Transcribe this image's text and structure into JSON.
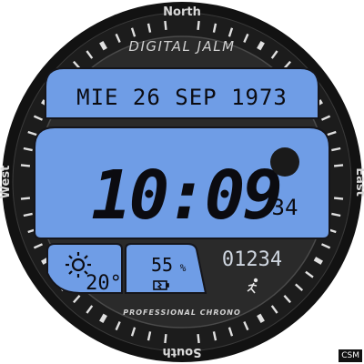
{
  "bezel": {
    "north": "North",
    "south": "South",
    "east": "East",
    "west": "West"
  },
  "brand": "DIGITAL JALM",
  "date": {
    "text": "MIE 26 SEP 1973"
  },
  "time": {
    "hours_minutes": "10:09",
    "seconds": "34"
  },
  "weather": {
    "icon": "sun-icon",
    "temperature": "20°"
  },
  "battery": {
    "icon": "battery-icon",
    "percent": "55",
    "unit": "%"
  },
  "steps": {
    "icon": "runner-icon",
    "count": "01234"
  },
  "footer_label": "PROFESSIONAL CHRONO",
  "badge": "CSM",
  "colors": {
    "lcd_blue": "#6f9de6",
    "bezel": "#1a1a1a",
    "inner_ring": "#2b2b2b",
    "indicator_dot": "#1a1a1a"
  }
}
